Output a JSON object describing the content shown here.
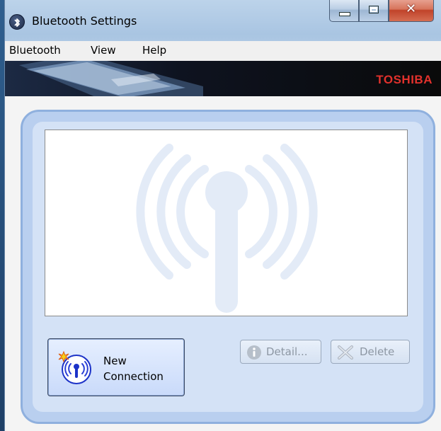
{
  "window": {
    "title": "Bluetooth Settings"
  },
  "menubar": {
    "items": [
      "Bluetooth",
      "View",
      "Help"
    ]
  },
  "banner": {
    "brand": "TOSHIBA"
  },
  "buttons": {
    "new_connection_line1": "New",
    "new_connection_line2": "Connection",
    "detail": "Detail...",
    "delete": "Delete"
  },
  "colors": {
    "brand_red": "#e1312c",
    "panel_blue": "#b9cfef",
    "watermark": "#e3ebf7"
  }
}
